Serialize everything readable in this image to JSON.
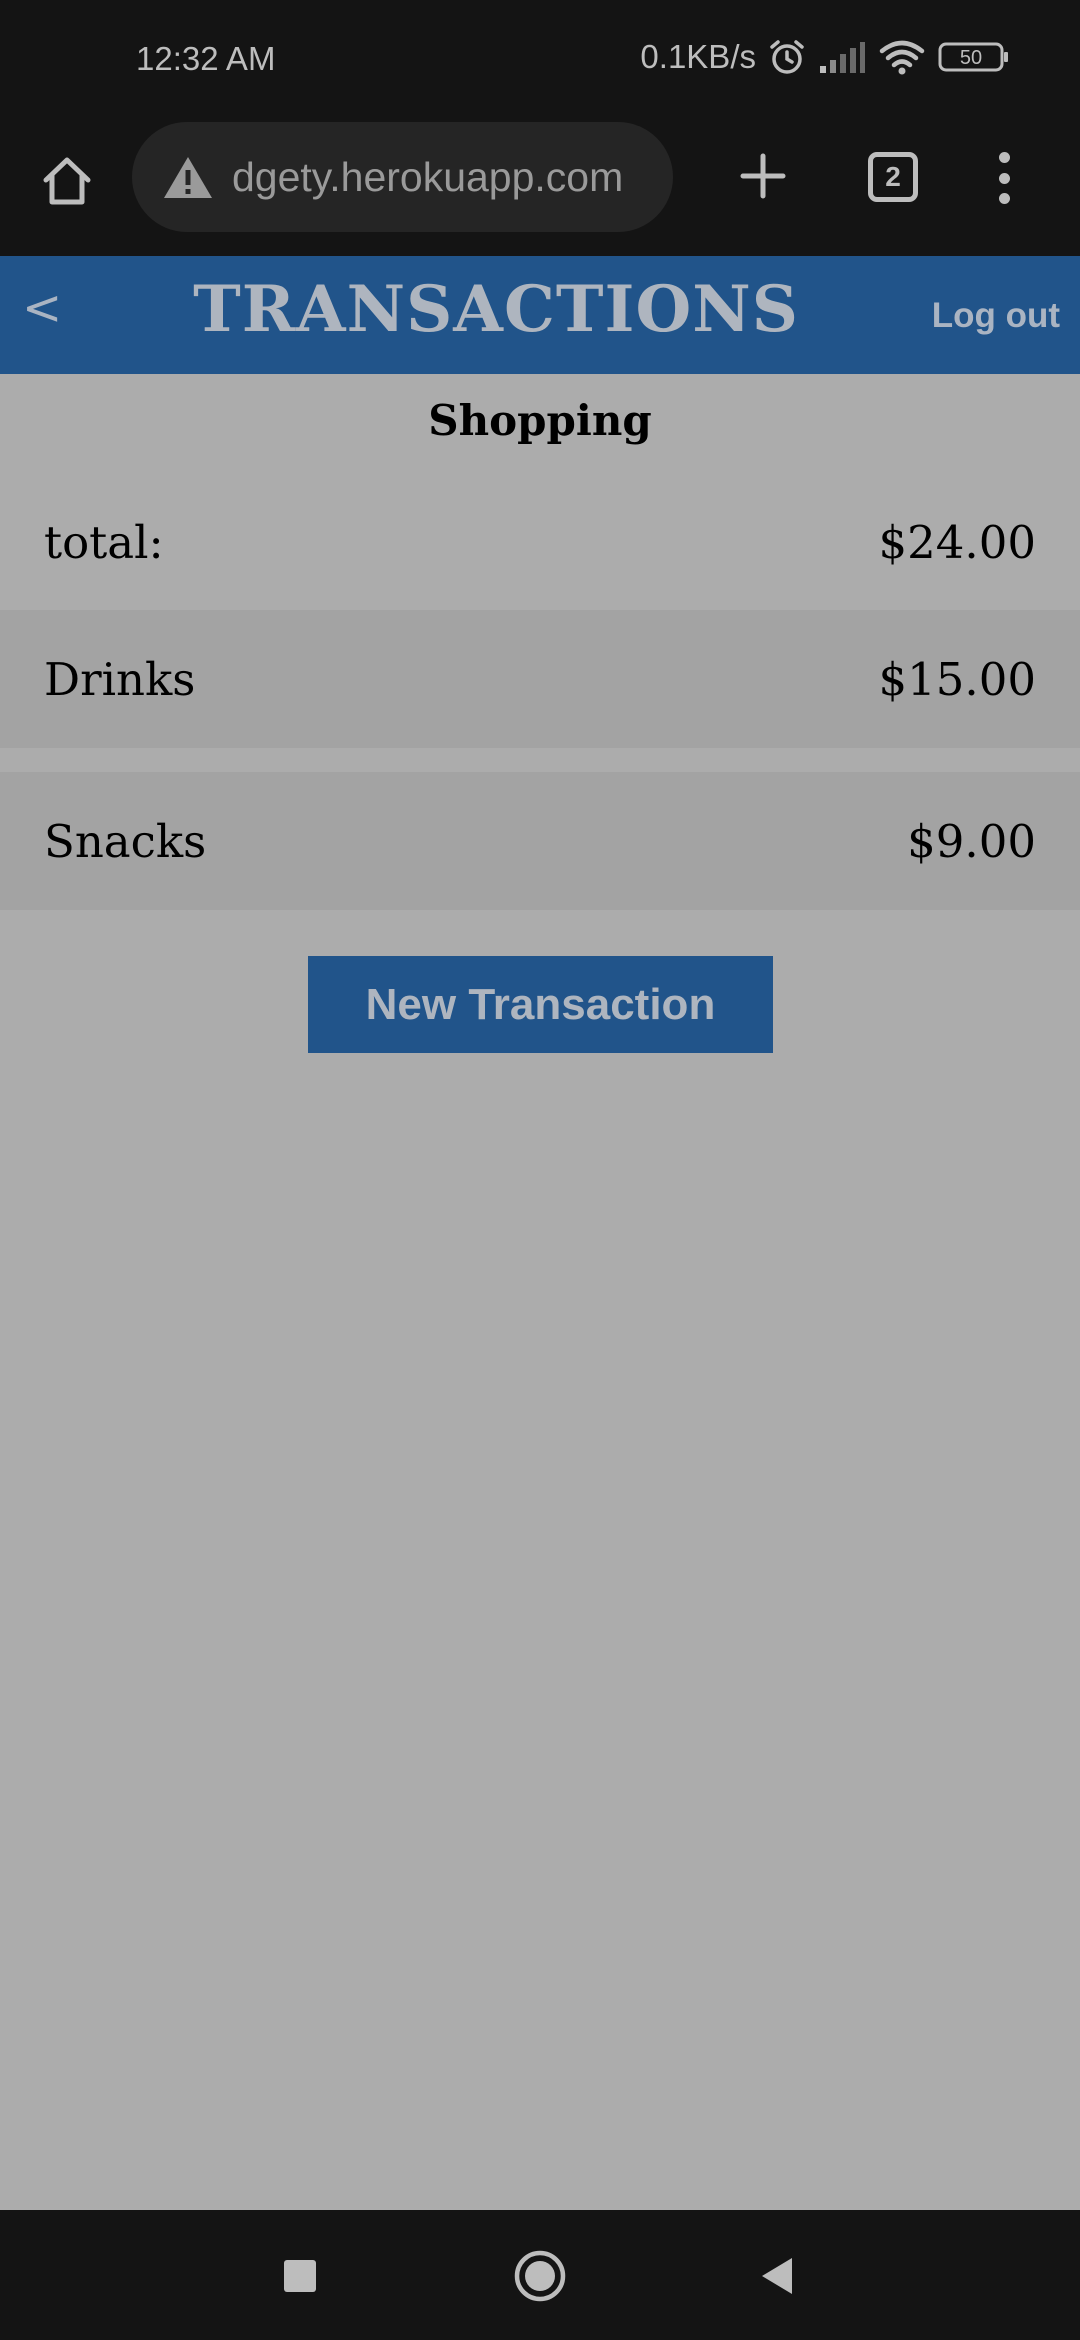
{
  "status_bar": {
    "time": "12:32 AM",
    "net_speed": "0.1KB/s",
    "battery": "50",
    "icons": [
      "alarm-icon",
      "signal-icon",
      "wifi-icon",
      "battery-icon"
    ]
  },
  "browser": {
    "url": "dgety.herokuapp.com",
    "tab_count": "2",
    "icons": [
      "home-icon",
      "warning-icon",
      "plus-icon",
      "tabs-icon",
      "more-vert-icon"
    ]
  },
  "header": {
    "back_label": "<",
    "title": "TRANSACTIONS",
    "logout_label": "Log out",
    "color": "#21548a"
  },
  "category": {
    "name": "Shopping"
  },
  "summary": {
    "label": "total:",
    "amount": "$24.00"
  },
  "transactions": [
    {
      "name": "Drinks",
      "amount": "$15.00"
    },
    {
      "name": "Snacks",
      "amount": "$9.00"
    }
  ],
  "actions": {
    "new_transaction_label": "New Transaction"
  },
  "nav_bar": {
    "icons": [
      "recents-icon",
      "home-circle-icon",
      "back-triangle-icon"
    ]
  }
}
